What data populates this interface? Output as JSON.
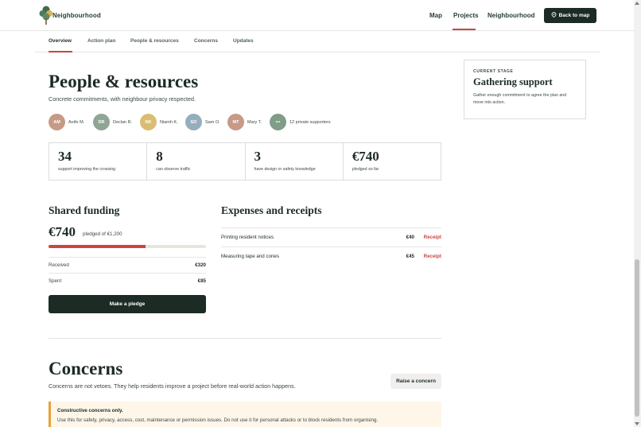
{
  "brand": {
    "name": "Neighbourhood",
    "logo_icon": "tree-icon"
  },
  "nav": {
    "items": [
      {
        "label": "Map"
      },
      {
        "label": "Projects",
        "active": true
      },
      {
        "label": "Neighbourhood"
      }
    ],
    "back_button": {
      "label": "Back to map",
      "icon": "map-pin-icon"
    }
  },
  "tabs": [
    {
      "label": "Overview",
      "active": true
    },
    {
      "label": "Action plan"
    },
    {
      "label": "People & resources"
    },
    {
      "label": "Concerns"
    },
    {
      "label": "Updates"
    }
  ],
  "people": {
    "title": "People & resources",
    "subtitle": "Concrete commitments, with neighbour privacy respected.",
    "supporters": [
      {
        "initials": "AM",
        "name": "Aoife M.",
        "color": "#c69a86"
      },
      {
        "initials": "DR",
        "name": "Declan R.",
        "color": "#8fa596"
      },
      {
        "initials": "NK",
        "name": "Niamh K.",
        "color": "#d8bd73"
      },
      {
        "initials": "SO",
        "name": "Sam O.",
        "color": "#95aebd"
      },
      {
        "initials": "MT",
        "name": "Mary T.",
        "color": "#c69a86"
      },
      {
        "initials": "•••",
        "name": "12 private supporters",
        "color": "#7f9d87"
      }
    ]
  },
  "stage": {
    "label": "CURRENT STAGE",
    "title": "Gathering support",
    "description": "Gather enough commitment to agree the plan and move into action."
  },
  "stats": [
    {
      "value": "34",
      "label": "support improving the crossing"
    },
    {
      "value": "8",
      "label": "can observe traffic"
    },
    {
      "value": "3",
      "label": "have design or safety knowledge"
    },
    {
      "value": "€740",
      "label": "pledged so far"
    }
  ],
  "funding": {
    "title": "Shared funding",
    "amount": "€740",
    "of_text": "pledged of €1,200",
    "progress": 0.617,
    "progress_color": "#c9473f",
    "rows": [
      {
        "label": "Received",
        "value": "€320"
      },
      {
        "label": "Spent",
        "value": "€85"
      }
    ],
    "pledge_button": "Make a pledge"
  },
  "expenses": {
    "title": "Expenses and receipts",
    "items": [
      {
        "description": "Printing resident notices",
        "amount": "€40",
        "link": "Receipt"
      },
      {
        "description": "Measuring tape and cones",
        "amount": "€45",
        "link": "Receipt"
      }
    ]
  },
  "concerns": {
    "title": "Concerns",
    "subtitle": "Concerns are not vetoes. They help residents improve a project before real-world action happens.",
    "raise_button": "Raise a concern",
    "notice": {
      "title": "Constructive concerns only.",
      "body": "Use this for safety, privacy, access, cost, maintenance or permission issues. Do not use it for personal attacks or to block residents from organising."
    }
  },
  "colors": {
    "accent": "#c9473f",
    "dark": "#1c2b24",
    "warning": "#e6a23c"
  }
}
